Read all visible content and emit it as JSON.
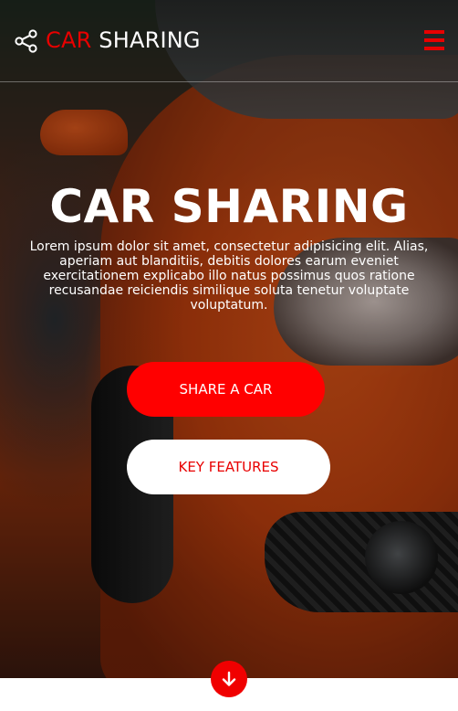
{
  "navbar": {
    "brand_accent": "CAR",
    "brand_rest": "SHARING"
  },
  "hero": {
    "title": "CAR SHARING",
    "text": "Lorem ipsum dolor sit amet, consectetur adipisicing elit. Alias, aperiam aut blanditiis, debitis dolores earum eveniet exercitationem explicabo illo natus possimus quos ratione recusandae reiciendis similique soluta tenetur voluptate voluptatum."
  },
  "buttons": {
    "share": "SHARE A CAR",
    "features": "KEY FEATURES"
  },
  "icons": {
    "share": "share-icon",
    "menu": "hamburger-menu-icon",
    "scroll": "arrow-down-icon"
  },
  "colors": {
    "accent": "#e80000",
    "button_primary": "#ff0000",
    "text": "#ffffff"
  }
}
